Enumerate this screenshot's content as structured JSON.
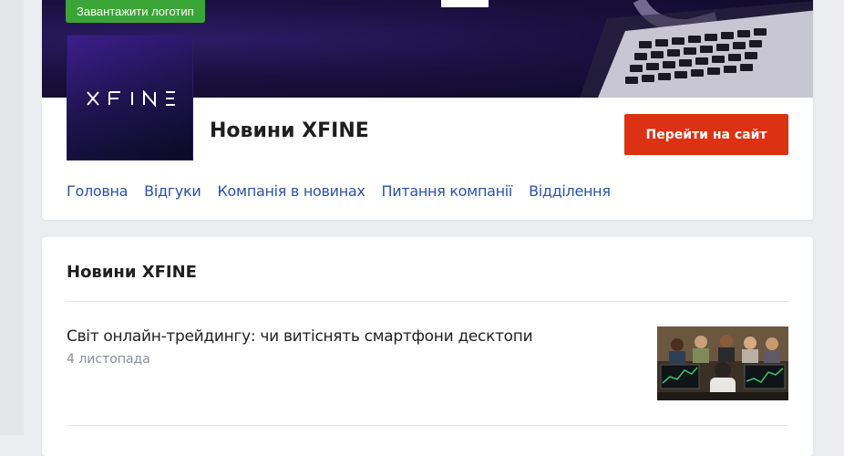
{
  "header": {
    "upload_logo_label": "Завантажити логотип",
    "logo_text": "XFINE",
    "company_title": "Новини XFINE",
    "site_button_label": "Перейти на сайт"
  },
  "tabs": [
    {
      "label": "Головна"
    },
    {
      "label": "Відгуки"
    },
    {
      "label": "Компанія в новинах"
    },
    {
      "label": "Питання компанії"
    },
    {
      "label": "Відділення"
    }
  ],
  "news": {
    "heading": "Новини XFINE",
    "items": [
      {
        "title": "Світ онлайн-трейдингу: чи витіснять смартфони десктопи",
        "date": "4 листопада"
      }
    ]
  },
  "colors": {
    "accent_green": "#3aa536",
    "accent_red": "#dc3112",
    "link_blue": "#2a52a4",
    "brand_purple": "#2d1b66"
  }
}
